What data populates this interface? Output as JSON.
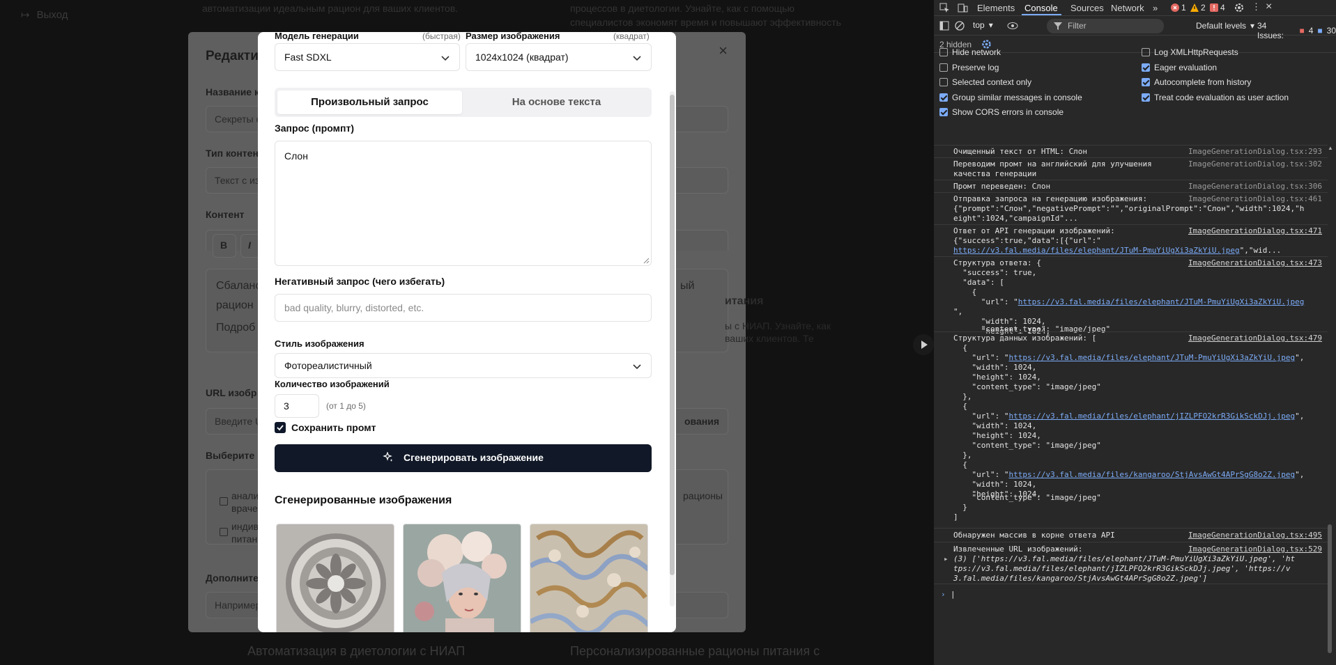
{
  "background": {
    "exit_label": "Выход",
    "top_text_left": "автоматизации идеальным рацион для ваших клиентов.",
    "top_text_right": "процессов в диетологии. Узнайте, как с помощью",
    "top_text_right2": "специалистов экономят время и повышают эффективность",
    "bottom_left": "Автоматизация в диетологии с НИАП",
    "bottom_right": "Персонализированные рационы питания с",
    "right_card_title": "итания",
    "right_card_text1": "ы с НИАП. Узнайте, как",
    "right_card_text2": "ваших клиентов. Те",
    "right_field_text": "ования",
    "right_list_text": "рационы"
  },
  "editor": {
    "title": "Редактир",
    "name_label": "Название к",
    "name_value": "Секреты с",
    "type_label": "Тип контен",
    "type_value": "Текст с из",
    "content_label": "Контент",
    "bold_btn": "B",
    "italic_btn": "I",
    "content_line1": "Сбаланс",
    "content_line2": "рацион",
    "content_line3": "Подроб",
    "content_right": "ый",
    "url_label": "URL изобр",
    "url_placeholder": "Введите U",
    "choose_label": "Выберите к",
    "opt1_line1": "анали",
    "opt1_line2": "враче",
    "opt2_line1": "индив",
    "opt2_line2": "питан",
    "extra_label": "Дополните",
    "extra_placeholder": "Например"
  },
  "modal": {
    "model_label": "Модель генерации",
    "model_hint": "(быстрая)",
    "model_value": "Fast SDXL",
    "size_label": "Размер изображения",
    "size_hint": "(квадрат)",
    "size_value": "1024x1024 (квадрат)",
    "tab_free": "Произвольный запрос",
    "tab_text": "На основе текста",
    "prompt_label": "Запрос (промпт)",
    "prompt_value": "Слон",
    "neg_label": "Негативный запрос (чего избегать)",
    "neg_placeholder": "bad quality, blurry, distorted, etc.",
    "style_label": "Стиль изображения",
    "style_value": "Фотореалистичный",
    "count_label": "Количество изображений",
    "count_value": "3",
    "count_hint": "(от 1 до 5)",
    "save_prompt_label": "Сохранить промт",
    "generate_label": "Сгенерировать изображение",
    "results_title": "Сгенерированные изображения"
  },
  "devtools": {
    "tabs": [
      "Elements",
      "Console",
      "Sources",
      "Network"
    ],
    "err_count": "1",
    "warn_count": "2",
    "issue_count_badge": "4",
    "context": "top",
    "filter_placeholder": "Filter",
    "levels": "Default levels",
    "issues_label": "34 Issues:",
    "issues_err": "4",
    "issues_info": "30",
    "hidden": "2 hidden",
    "options_left": [
      "Hide network",
      "Preserve log",
      "Selected context only",
      "Group similar messages in console",
      "Show CORS errors in console"
    ],
    "options_right": [
      "Log XMLHttpRequests",
      "Eager evaluation",
      "Autocomplete from history",
      "Treat code evaluation as user action"
    ],
    "options_left_checked": [
      false,
      false,
      false,
      true,
      true
    ],
    "options_right_checked": [
      false,
      true,
      true,
      true
    ],
    "messages": [
      {
        "text": "Очищенный текст от HTML: Слон",
        "src": "ImageGenerationDialog.tsx:293"
      },
      {
        "text": "Переводим промт на английский для улучшения",
        "text2": "качества генерации",
        "src": "ImageGenerationDialog.tsx:302"
      },
      {
        "text": "Промт переведен: Слон",
        "src": "ImageGenerationDialog.tsx:306"
      },
      {
        "text": "Отправка запроса на генерацию изображения:",
        "text2": "{\"prompt\":\"Слон\",\"negativePrompt\":\"\",\"originalPrompt\":\"Слон\",\"width\":1024,\"h",
        "text3": "eight\":1024,\"campaignId\"...",
        "src": "ImageGenerationDialog.tsx:461"
      },
      {
        "text": "Ответ от API генерации изображений:",
        "text2": "{\"success\":true,\"data\":[{\"url\":\"",
        "text3": "https://v3.fal.media/files/elephant/JTuM-PmuYiUgXi3aZkYiU.jpeg",
        "text3b": "\",\"wid...",
        "src": "ImageGenerationDialog.tsx:471"
      },
      {
        "text": "Структура ответа: {",
        "src": "ImageGenerationDialog.tsx:473"
      },
      {
        "text": "Структура данных изображений: [",
        "src": "ImageGenerationDialog.tsx:479"
      },
      {
        "text": "Обнаружен массив в корне ответа API",
        "src": "ImageGenerationDialog.tsx:495"
      },
      {
        "text": "Извлеченные URL изображений:",
        "src": "ImageGenerationDialog.tsx:529"
      }
    ],
    "struct_lines": [
      "  \"success\": true,",
      "  \"data\": [",
      "    {",
      "      \"url\": \"",
      "\",",
      "      \"width\": 1024,",
      "      \"height\": 1024,",
      "      \"content_type\": \"image/jpeg\""
    ],
    "url1": "https://v3.fal.media/files/elephant/JTuM-PmuYiUgXi3aZkYiU.jpeg",
    "url2": "https://v3.fal.media/files/elephant/jIZLPFO2krR3GikSckDJj.jpeg",
    "url3": "https://v3.fal.media/files/kangaroo/StjAvsAwGt4APrSgG8o2Z.jpeg",
    "arr_line1": "(3) ['https://v3.fal.media/files/elephant/JTuM-PmuYiUgXi3aZkYiU.jpeg', 'ht",
    "arr_line2": "tps://v3.fal.media/files/elephant/jIZLPFO2krR3GikSckDJj.jpeg', 'https://v",
    "arr_line3": "3.fal.media/files/kangaroo/StjAvsAwGt4APrSgG8o2Z.jpeg']"
  },
  "colors": {
    "primary_button": "#111827",
    "devtools_bg": "#282828",
    "link": "#7cacf8"
  }
}
